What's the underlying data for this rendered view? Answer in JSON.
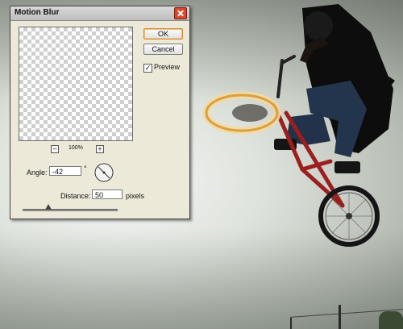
{
  "dialog": {
    "title": "Motion Blur",
    "ok_label": "OK",
    "cancel_label": "Cancel",
    "preview_label": "Preview",
    "preview_checked": true,
    "zoom_out": "–",
    "zoom_in": "+",
    "zoom_level": "100%",
    "angle_label": "Angle:",
    "angle_value": "-42",
    "angle_unit": "°",
    "distance_label": "Distance:",
    "distance_value": "50",
    "distance_unit": "pixels"
  },
  "colors": {
    "dialog_bg": "#ece9d8",
    "close_button": "#d9482a",
    "bike_frame": "#9c1e1e"
  },
  "icons": {
    "close": "close-icon",
    "checkbox": "check-icon",
    "angle_dial": "angle-dial-icon",
    "slider": "slider-thumb-icon"
  }
}
